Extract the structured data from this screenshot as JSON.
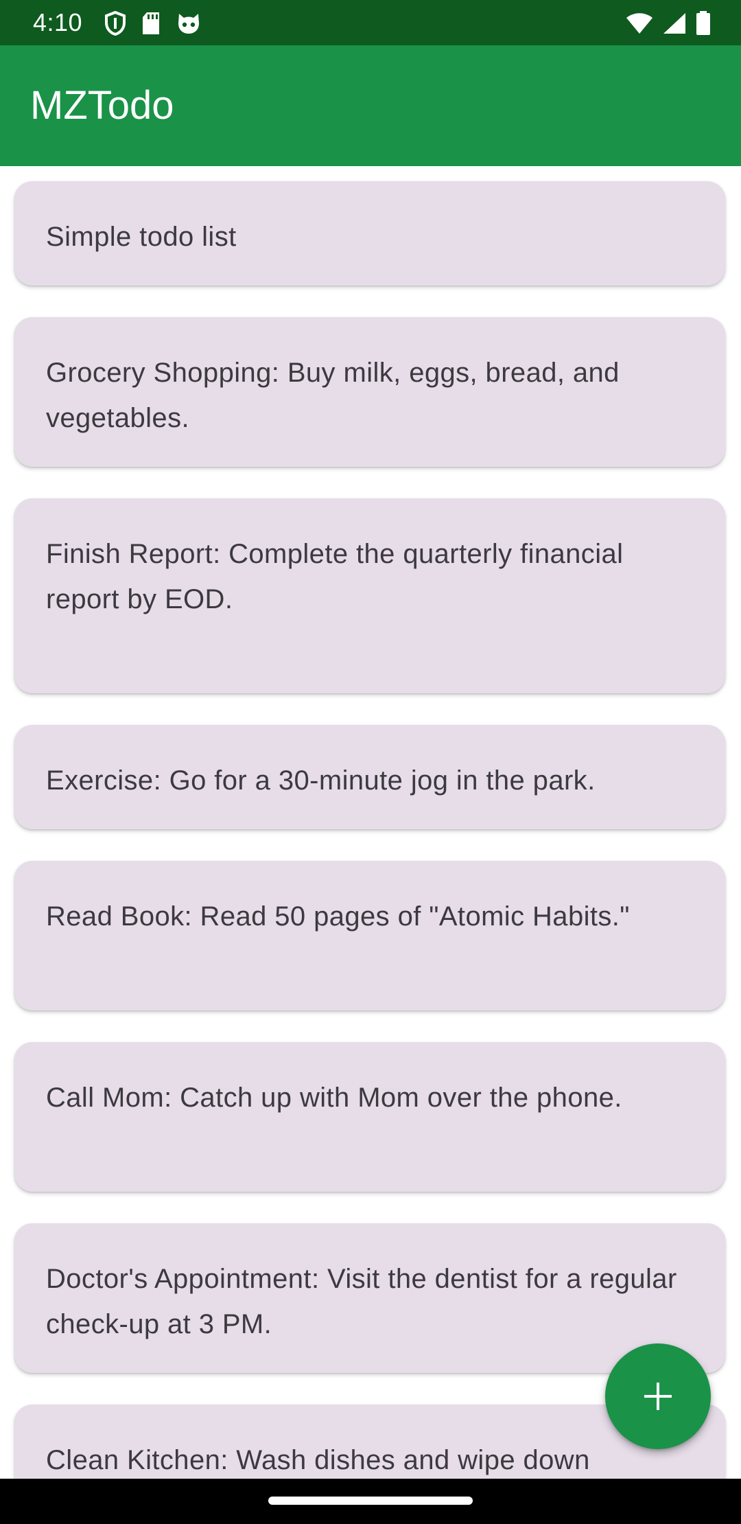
{
  "status_bar": {
    "time": "4:10",
    "left_icons": [
      "shield-icon",
      "sd-card-icon",
      "cat-face-icon"
    ],
    "right_icons": [
      "wifi-icon",
      "cell-signal-icon",
      "battery-icon"
    ]
  },
  "app_bar": {
    "title": "MZTodo"
  },
  "todos": [
    {
      "text": "Simple todo list"
    },
    {
      "text": "Grocery Shopping: Buy milk, eggs, bread, and vegetables."
    },
    {
      "text": "Finish Report: Complete the quarterly financial report by EOD."
    },
    {
      "text": "Exercise: Go for a 30-minute jog in the park."
    },
    {
      "text": "Read Book: Read 50 pages of \"Atomic Habits.\""
    },
    {
      "text": "Call Mom: Catch up with Mom over the phone."
    },
    {
      "text": "Doctor's Appointment: Visit the dentist for a regular check-up at 3 PM."
    },
    {
      "text": "Clean Kitchen: Wash dishes and wipe down"
    }
  ],
  "fab": {
    "icon": "plus-icon"
  },
  "colors": {
    "status_bar": "#0e5a1f",
    "app_bar": "#1a9248",
    "card": "#e6dde9",
    "fab": "#1a9248"
  }
}
